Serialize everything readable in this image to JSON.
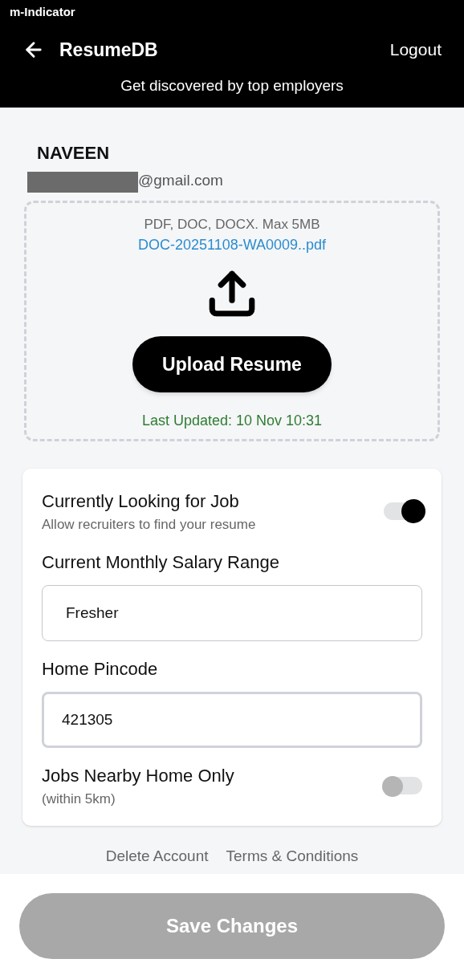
{
  "status_bar": {
    "app_name": "m-Indicator"
  },
  "header": {
    "title": "ResumeDB",
    "action": "Logout",
    "tagline": "Get discovered by top employers"
  },
  "profile": {
    "name": "NAVEEN",
    "email": "@gmail.com"
  },
  "upload": {
    "hint": "PDF, DOC, DOCX. Max 5MB",
    "file_name": "DOC-20251108-WA0009..pdf",
    "button": "Upload Resume",
    "last_updated": "Last Updated: 10 Nov 10:31"
  },
  "settings": [
    {
      "kind": "toggle",
      "label": "Currently Looking for Job",
      "sublabel": "Allow recruiters to find your resume",
      "on": true
    },
    {
      "kind": "field",
      "label": "Current Monthly Salary Range",
      "value": "Fresher",
      "focused": false
    },
    {
      "kind": "field",
      "label": "Home Pincode",
      "value": "421305",
      "focused": true
    },
    {
      "kind": "toggle",
      "label": "Jobs Nearby Home Only",
      "sublabel": "(within 5km)",
      "on": false
    }
  ],
  "links": [
    "Delete Account",
    "Terms & Conditions"
  ],
  "save_button": {
    "label": "Save Changes",
    "disabled": true
  }
}
